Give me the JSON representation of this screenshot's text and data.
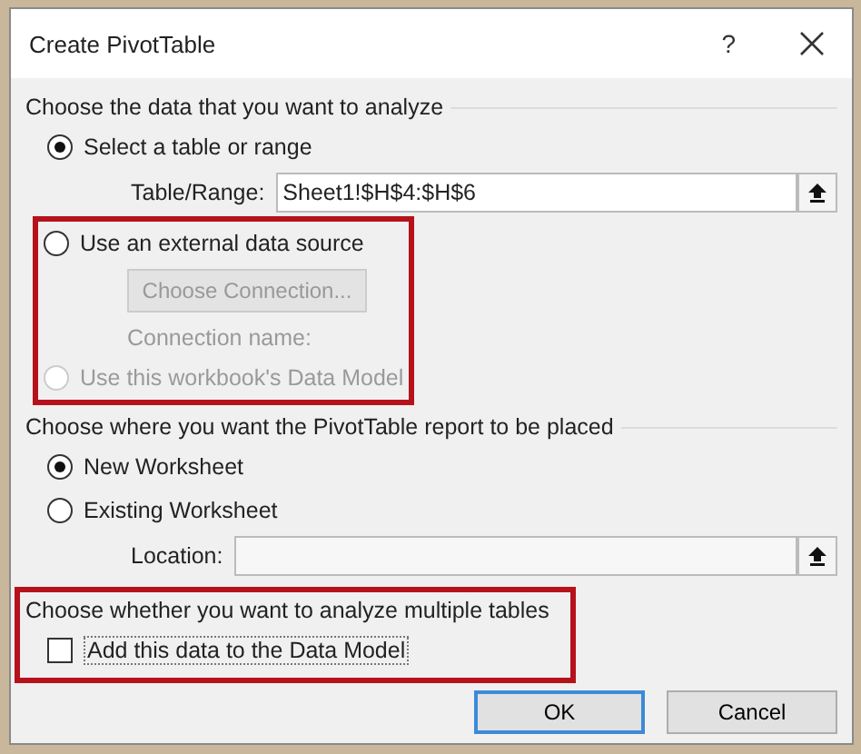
{
  "window": {
    "title": "Create PivotTable",
    "help": "?"
  },
  "sections": [
    {
      "heading": "Choose the data that you want to analyze",
      "items": [
        {
          "kind": "radio",
          "label": "Select a table or range",
          "selected": true,
          "disabled": false
        },
        {
          "kind": "field",
          "label": "Table/Range:",
          "value": "Sheet1!$H$4:$H$6"
        },
        {
          "kind": "frame",
          "highlighted": true,
          "items": [
            {
              "kind": "radio",
              "label": "Use an external data source",
              "selected": false,
              "disabled": false
            },
            {
              "kind": "button",
              "label": "Choose Connection...",
              "disabled": true
            },
            {
              "kind": "note",
              "text": "Connection name:",
              "disabled": true
            },
            {
              "kind": "radio",
              "label": "Use this workbook's Data Model",
              "selected": false,
              "disabled": true
            }
          ]
        }
      ]
    },
    {
      "heading": "Choose where you want the PivotTable report to be placed",
      "items": [
        {
          "kind": "radio",
          "label": "New Worksheet",
          "selected": true,
          "disabled": false
        },
        {
          "kind": "radio",
          "label": "Existing Worksheet",
          "selected": false,
          "disabled": false
        },
        {
          "kind": "field",
          "label": "Location:"
        }
      ]
    },
    {
      "heading": "Choose whether you want to analyze multiple tables",
      "highlighted": true,
      "items": [
        {
          "kind": "checkbox",
          "label": "Add this data to the Data Model",
          "checked": false
        }
      ]
    }
  ],
  "buttons": [
    {
      "label": "OK",
      "default": true
    },
    {
      "label": "Cancel",
      "default": false
    }
  ]
}
